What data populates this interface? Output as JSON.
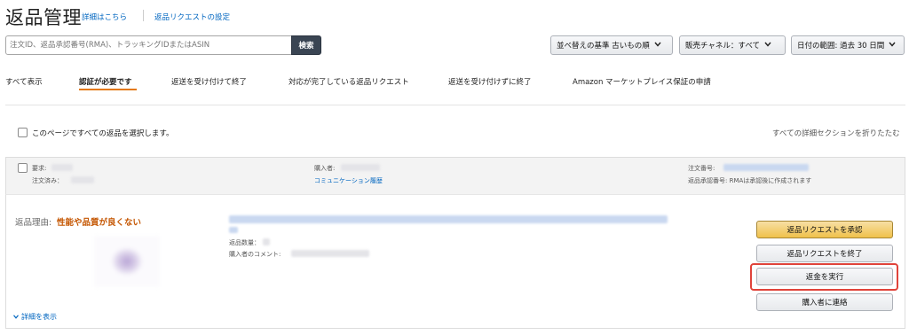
{
  "header": {
    "title": "返品管理",
    "details_link": "詳細はこちら",
    "settings_link": "返品リクエストの設定"
  },
  "search": {
    "placeholder": "注文ID、返品承認番号(RMA)、トラッキングIDまたはASIN",
    "button_label": "検索"
  },
  "filters": {
    "sort": "並べ替えの基準 古いもの順",
    "channel": "販売チャネル：すべて",
    "date_range": "日付の範囲: 過去 30 日間"
  },
  "tabs": [
    {
      "label": "すべて表示",
      "active": false
    },
    {
      "label": "認証が必要です",
      "active": true
    },
    {
      "label": "返送を受け付けて終了",
      "active": false
    },
    {
      "label": "対応が完了している返品リクエスト",
      "active": false
    },
    {
      "label": "返送を受け付けずに終了",
      "active": false
    },
    {
      "label": "Amazon マーケットプレイス保証の申請",
      "active": false
    }
  ],
  "select_all_label": "このページですべての返品を選択します。",
  "collapse_all_label": "すべての詳細セクションを折りたたむ",
  "order": {
    "request_label": "要求:",
    "ordered_label": "注文済み：",
    "buyer_label": "購入者:",
    "communication_link": "コミュニケーション履歴",
    "order_number_label": "注文番号:",
    "rma_label": "返品承認番号: RMAは承認後に作成されます",
    "reason_label": "返品理由:",
    "reason_value": "性能や品質が良くない",
    "quantity_label": "返品数量：",
    "comment_label": "購入者のコメント:",
    "show_details": "詳細を表示"
  },
  "actions": {
    "approve": "返品リクエストを承認",
    "close": "返品リクエストを終了",
    "refund": "返金を実行",
    "contact": "購入者に連絡"
  },
  "colors": {
    "accent_tab": "#e47911",
    "reason": "#c45500",
    "link": "#0066c0",
    "highlight": "#e0433a"
  }
}
